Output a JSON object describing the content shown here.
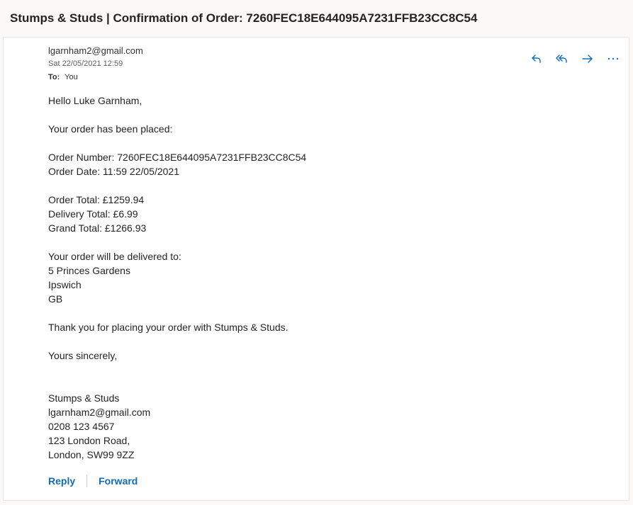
{
  "subject": "Stumps & Studs | Confirmation of Order: 7260FEC18E644095A7231FFB23CC8C54",
  "header": {
    "sender": "lgarnham2@gmail.com",
    "date": "Sat 22/05/2021 12:59",
    "to_label": "To:",
    "to_value": "You"
  },
  "icons": {
    "reply": "reply-icon",
    "reply_all": "reply-all-icon",
    "forward": "forward-icon",
    "more": "more-icon"
  },
  "body": {
    "greeting": "Hello Luke Garnham,",
    "placed": "Your order has been placed:",
    "order_number": "Order Number: 7260FEC18E644095A7231FFB23CC8C54",
    "order_date": "Order Date: 11:59 22/05/2021",
    "order_total": "Order Total: £1259.94",
    "delivery_total": "Delivery Total: £6.99",
    "grand_total": "Grand Total: £1266.93",
    "delivered_to": "Your order will be delivered to:",
    "address": [
      "5 Princes Gardens",
      "Ipswich",
      "GB"
    ],
    "thanks": "Thank you for placing your order with Stumps & Studs.",
    "signoff": "Yours sincerely,",
    "signature": [
      "Stumps & Studs",
      "lgarnham2@gmail.com",
      "0208 123 4567",
      "123 London Road,",
      "London, SW99 9ZZ"
    ]
  },
  "footer": {
    "reply_label": "Reply",
    "forward_label": "Forward"
  },
  "colors": {
    "accent": "#0f6cbd",
    "background": "#faf9f8",
    "card": "#ffffff"
  }
}
